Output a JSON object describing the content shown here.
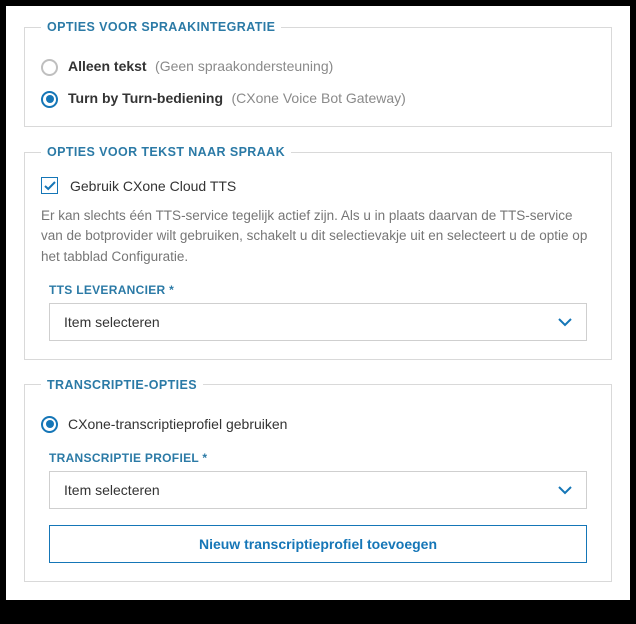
{
  "voice_integration": {
    "legend": "OPTIES VOOR SPRAAKINTEGRATIE",
    "options": [
      {
        "label": "Alleen tekst",
        "hint": "(Geen spraakondersteuning)",
        "selected": false
      },
      {
        "label": "Turn by Turn-bediening",
        "hint": "(CXone Voice Bot Gateway)",
        "selected": true
      }
    ]
  },
  "tts": {
    "legend": "OPTIES VOOR TEKST NAAR SPRAAK",
    "checkbox_label": "Gebruik CXone Cloud TTS",
    "checkbox_checked": true,
    "description": "Er kan slechts één TTS-service tegelijk actief zijn. Als u in plaats daarvan de TTS-service van de botprovider wilt gebruiken, schakelt u dit selectievakje uit en selecteert u de optie op het tabblad Configuratie.",
    "provider_label": "TTS LEVERANCIER *",
    "provider_value": "Item selecteren"
  },
  "transcription": {
    "legend": "TRANSCRIPTIE-OPTIES",
    "option_label": "CXone-transcriptieprofiel gebruiken",
    "option_selected": true,
    "profile_label": "TRANSCRIPTIE PROFIEL *",
    "profile_value": "Item selecteren",
    "add_button": "Nieuw transcriptieprofiel toevoegen"
  },
  "colors": {
    "accent": "#1576b7",
    "legend": "#2b7aa6",
    "muted": "#767676"
  }
}
